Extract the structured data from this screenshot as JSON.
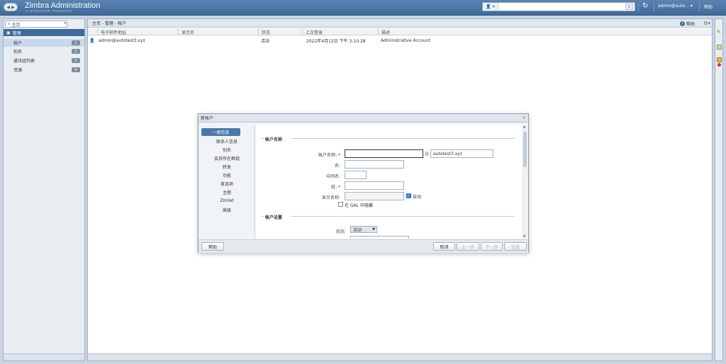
{
  "header": {
    "title": "Zimbra Administration",
    "subtitle": "A SYNACOR PRODUCT",
    "user": "admin@auto...",
    "help": "帮助"
  },
  "sidebar": {
    "view_select": "主页",
    "root_label": "管理",
    "items": [
      {
        "label": "帐户",
        "count": "1"
      },
      {
        "label": "别名",
        "count": "2"
      },
      {
        "label": "通讯组列表",
        "count": "2"
      },
      {
        "label": "资源",
        "count": "0"
      }
    ]
  },
  "main": {
    "breadcrumb": "主页 - 管理 - 帐户",
    "help_label": "帮助",
    "columns": [
      "电子邮件地址",
      "显示名",
      "状态",
      "上次登录",
      "描述"
    ],
    "rows": [
      {
        "email": "admin@autotest3.xyz",
        "display_name": "",
        "status": "活动",
        "last_login": "2022年4月12日 下午 3:10:28",
        "description": "Administrative Account"
      }
    ]
  },
  "dialog": {
    "title": "新帐户",
    "nav": [
      "一般信息",
      "联系人信息",
      "别名",
      "会员所在群组",
      "转发",
      "功能",
      "首选项",
      "主题",
      "Zimlet",
      "高级"
    ],
    "section_account_name": "帐户名称",
    "label_account_name": "帐户名称:",
    "domain_value": "autotest3.xyz",
    "label_first_name": "名:",
    "label_middle_name": "中间名:",
    "label_last_name": "姓:",
    "label_display_name": "显示名称:",
    "auto_label": "自动",
    "hide_gal_label": "在 GAL 中隐藏",
    "section_account_settings": "帐户设置",
    "label_status": "状态:",
    "status_value": "活动",
    "buttons": {
      "help": "帮助",
      "cancel": "取消",
      "prev": "上一步",
      "next": "下一步",
      "finish": "完成"
    }
  }
}
